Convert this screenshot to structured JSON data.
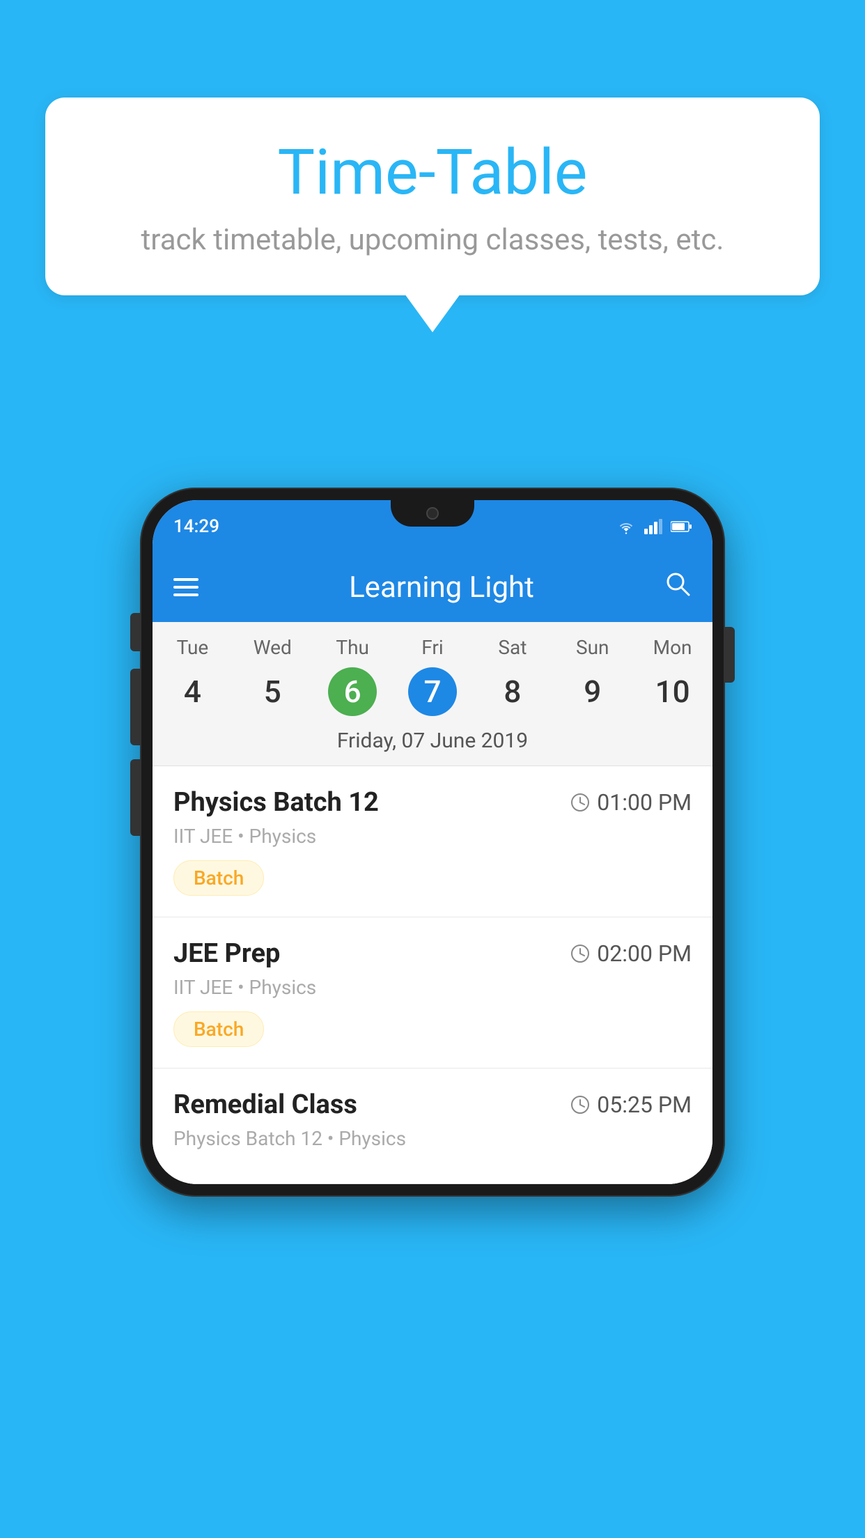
{
  "background_color": "#29B6F6",
  "speech_bubble": {
    "title": "Time-Table",
    "subtitle": "track timetable, upcoming classes, tests, etc."
  },
  "phone": {
    "status_bar": {
      "time": "14:29",
      "icons": [
        "wifi",
        "signal",
        "battery"
      ]
    },
    "toolbar": {
      "title": "Learning Light",
      "menu_icon": "menu",
      "search_icon": "search"
    },
    "calendar": {
      "days": [
        {
          "name": "Tue",
          "number": "4",
          "state": "normal"
        },
        {
          "name": "Wed",
          "number": "5",
          "state": "normal"
        },
        {
          "name": "Thu",
          "number": "6",
          "state": "today"
        },
        {
          "name": "Fri",
          "number": "7",
          "state": "selected"
        },
        {
          "name": "Sat",
          "number": "8",
          "state": "normal"
        },
        {
          "name": "Sun",
          "number": "9",
          "state": "normal"
        },
        {
          "name": "Mon",
          "number": "10",
          "state": "normal"
        }
      ],
      "selected_date_label": "Friday, 07 June 2019"
    },
    "schedule": [
      {
        "title": "Physics Batch 12",
        "time": "01:00 PM",
        "meta": "IIT JEE • Physics",
        "tag": "Batch"
      },
      {
        "title": "JEE Prep",
        "time": "02:00 PM",
        "meta": "IIT JEE • Physics",
        "tag": "Batch"
      },
      {
        "title": "Remedial Class",
        "time": "05:25 PM",
        "meta": "Physics Batch 12 • Physics",
        "tag": ""
      }
    ]
  }
}
